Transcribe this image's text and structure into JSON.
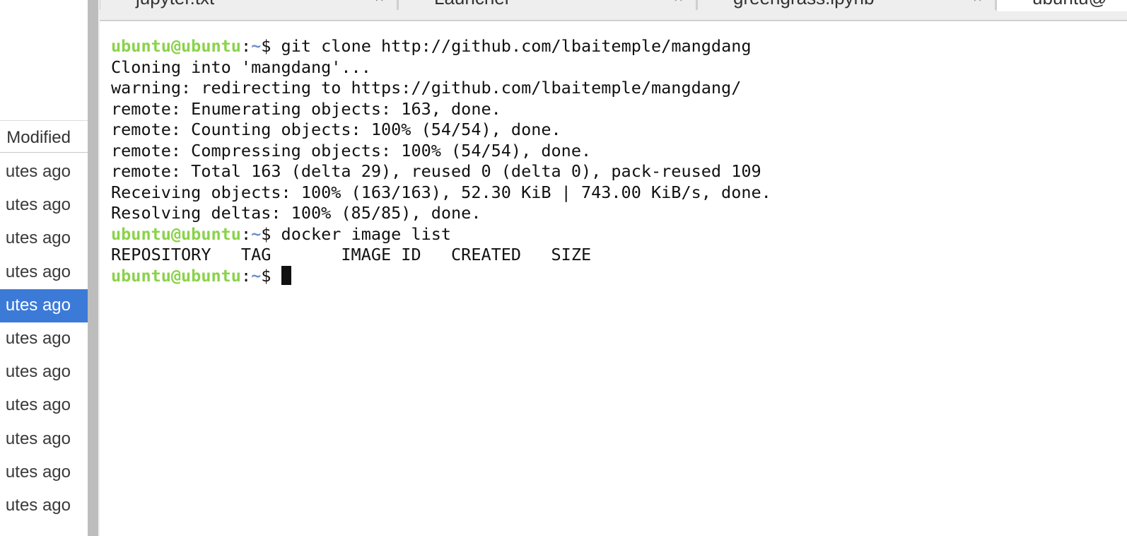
{
  "file_browser": {
    "column_header": "Modified",
    "rows": [
      "utes ago",
      "utes ago",
      "utes ago",
      "utes ago",
      "utes ago",
      "utes ago",
      "utes ago",
      "utes ago",
      "utes ago",
      "utes ago",
      "utes ago"
    ],
    "selected_row_index": 4
  },
  "tabs": [
    {
      "label": "jupyter.txt",
      "icon": "file-icon"
    },
    {
      "label": "Launcher",
      "icon": "launcher-icon"
    },
    {
      "label": "greengrass.ipynb",
      "icon": "notebook-icon"
    },
    {
      "label": "ubuntu@",
      "icon": "terminal-icon"
    }
  ],
  "terminal": {
    "prompt_user": "ubuntu@ubuntu",
    "prompt_sep": ":",
    "prompt_path": "~",
    "prompt_symbol": "$ ",
    "lines": [
      {
        "type": "prompt",
        "text": "git clone http://github.com/lbaitemple/mangdang"
      },
      {
        "type": "output",
        "text": "Cloning into 'mangdang'..."
      },
      {
        "type": "output",
        "text": "warning: redirecting to https://github.com/lbaitemple/mangdang/"
      },
      {
        "type": "output",
        "text": "remote: Enumerating objects: 163, done."
      },
      {
        "type": "output",
        "text": "remote: Counting objects: 100% (54/54), done."
      },
      {
        "type": "output",
        "text": "remote: Compressing objects: 100% (54/54), done."
      },
      {
        "type": "output",
        "text": "remote: Total 163 (delta 29), reused 0 (delta 0), pack-reused 109"
      },
      {
        "type": "output",
        "text": "Receiving objects: 100% (163/163), 52.30 KiB | 743.00 KiB/s, done."
      },
      {
        "type": "output",
        "text": "Resolving deltas: 100% (85/85), done."
      },
      {
        "type": "prompt",
        "text": "docker image list"
      },
      {
        "type": "output",
        "text": "REPOSITORY   TAG       IMAGE ID   CREATED   SIZE"
      },
      {
        "type": "cursor",
        "text": ""
      }
    ]
  },
  "colors": {
    "selection": "#3c7ad8",
    "prompt_user": "#8ad34a",
    "prompt_path": "#6d8fc9"
  }
}
